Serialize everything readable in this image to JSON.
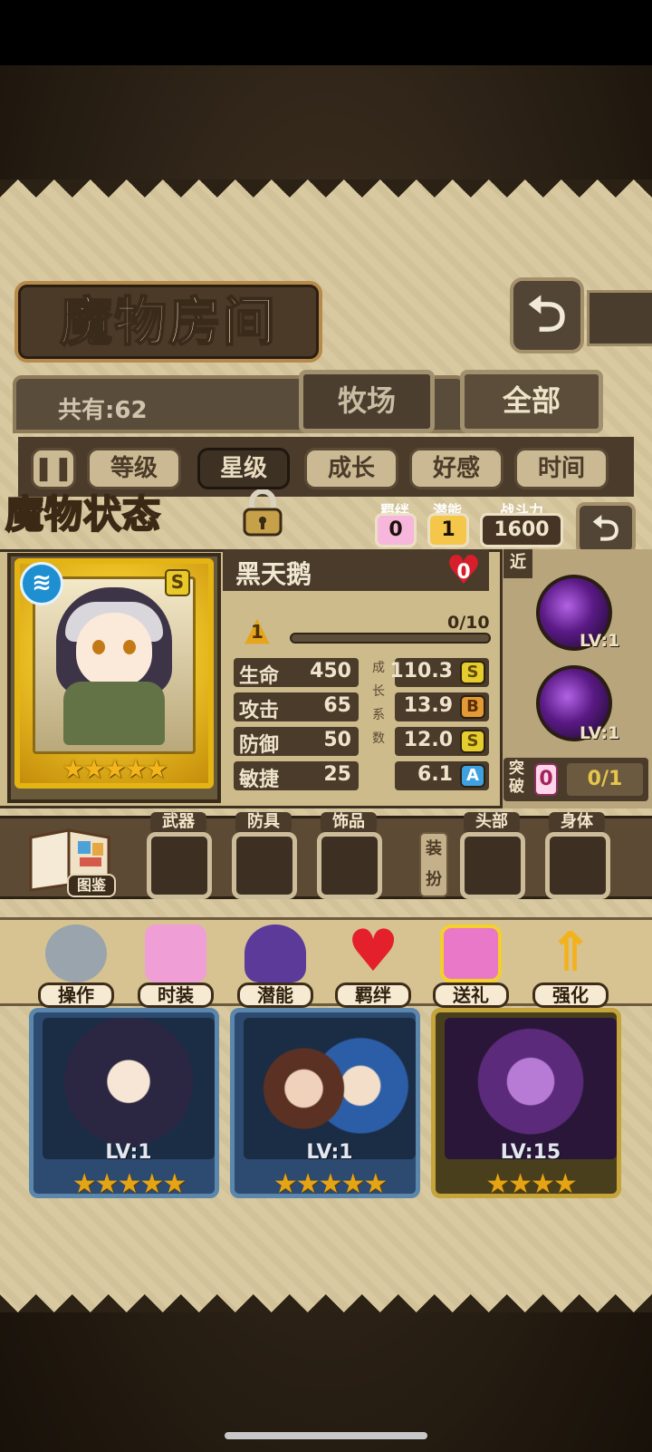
{
  "room": {
    "title": "魔物房间",
    "count_text": "共有:62",
    "back_icon": "return-arrow-icon",
    "tabs": [
      {
        "label": "牧场"
      },
      {
        "label": "全部"
      }
    ]
  },
  "sort": {
    "order_icon": "pause-sort-icon",
    "buttons": [
      {
        "label": "等级"
      },
      {
        "label": "星级"
      },
      {
        "label": "成长"
      },
      {
        "label": "好感"
      },
      {
        "label": "时间"
      }
    ],
    "active": "星级"
  },
  "status": {
    "title": "魔物状态",
    "bond_label": "羁绊",
    "bond_value": "0",
    "potential_label": "潜能",
    "potential_value": "1",
    "power_label": "战斗力",
    "power_value": "1600",
    "monster_name": "黑天鹅",
    "affection": "0",
    "level": "1",
    "xp_text": "0/10",
    "xp_progress": 0,
    "rank": "S",
    "stars": "★★★★★",
    "growth_vertical": [
      "成",
      "长",
      "系",
      "数"
    ],
    "stats": [
      {
        "label": "生命",
        "value": "450",
        "growth": "110.3",
        "grade": "S"
      },
      {
        "label": "攻击",
        "value": "65",
        "growth": "13.9",
        "grade": "B"
      },
      {
        "label": "防御",
        "value": "50",
        "growth": "12.0",
        "grade": "S"
      },
      {
        "label": "敏捷",
        "value": "25",
        "growth": "6.1",
        "grade": "A"
      }
    ],
    "range_tag": "近",
    "skills": [
      {
        "lv": "LV:1"
      },
      {
        "lv": "LV:1"
      }
    ],
    "breakthrough_label": "突破",
    "breakthrough_value": "0",
    "breakthrough_progress": "0/1"
  },
  "equipment": {
    "book_label": "图鉴",
    "slots": [
      {
        "label": "武器"
      },
      {
        "label": "防具"
      },
      {
        "label": "饰品"
      },
      {
        "label": "头部"
      },
      {
        "label": "身体"
      }
    ],
    "dress_tag": "装扮"
  },
  "actions": [
    {
      "label": "操作",
      "icon": "gear-icon",
      "color": "#9aa4ad"
    },
    {
      "label": "时装",
      "icon": "dress-icon",
      "color": "#ef9fd5"
    },
    {
      "label": "潜能",
      "icon": "demon-icon",
      "color": "#5b3a99"
    },
    {
      "label": "羁绊",
      "icon": "hearts-icon",
      "color": "#e3202b"
    },
    {
      "label": "送礼",
      "icon": "gift-icon",
      "color": "#e978c8"
    },
    {
      "label": "强化",
      "icon": "up-arrows-icon",
      "color": "#f3b21c"
    }
  ],
  "cards": [
    {
      "lv": "LV:1",
      "stars": "★★★★★"
    },
    {
      "lv": "LV:1",
      "stars": "★★★★★"
    },
    {
      "lv": "LV:15",
      "stars": "★★★★"
    }
  ]
}
